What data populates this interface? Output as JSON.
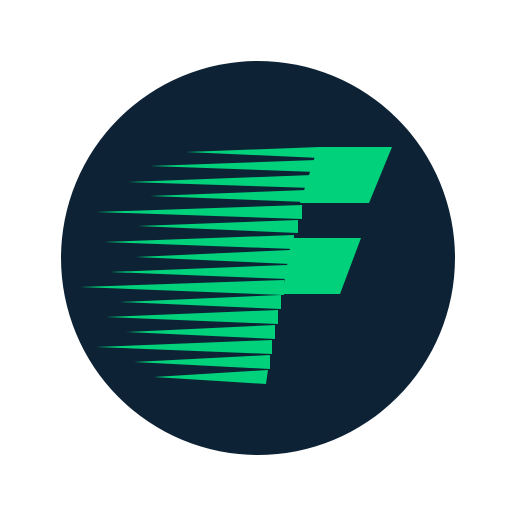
{
  "logo": {
    "icon": "speed-f-logo-icon",
    "circle_color": "#0d2235",
    "glyph_color": "#00d17a",
    "background_color": "#ffffff"
  }
}
